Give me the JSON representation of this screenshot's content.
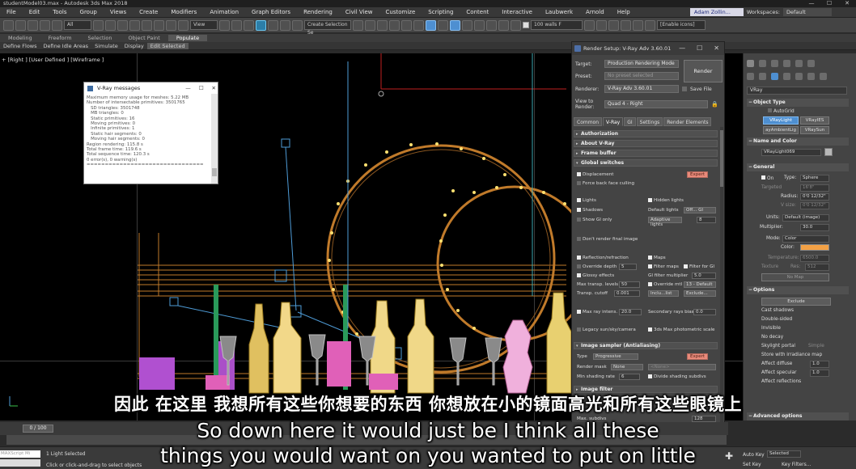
{
  "window": {
    "title": "studentModel03.max - Autodesk 3ds Max 2018",
    "controls": [
      "—",
      "☐",
      "✕"
    ]
  },
  "menubar": {
    "items": [
      "File",
      "Edit",
      "Tools",
      "Group",
      "Views",
      "Create",
      "Modifiers",
      "Animation",
      "Graph Editors",
      "Rendering",
      "Civil View",
      "Customize",
      "Scripting",
      "Content",
      "Interactive",
      "Laubwerk",
      "Arnold",
      "Help"
    ],
    "user": "Adam Zollin...",
    "workspaces_label": "Workspaces:",
    "workspace_value": "Default"
  },
  "toolbar": {
    "selection_filter": "All",
    "view_label": "View",
    "selection_set": "Create Selection Se",
    "layer_value": "100",
    "layer_name": "walls F",
    "enable_icons": "[Enable icons]"
  },
  "ribbon": {
    "tabs": [
      "Modeling",
      "Freeform",
      "Selection",
      "Object Paint",
      "Populate"
    ],
    "active_tab": "Populate",
    "sub_items": [
      "Define Flows",
      "Define Idle Areas",
      "Simulate",
      "Display",
      "Edit Selected"
    ],
    "active_sub": "Edit Selected"
  },
  "viewport": {
    "label": "+ [Right ] [User Defined ] [Wireframe ]"
  },
  "vray_messages": {
    "title": "V-Ray messages",
    "lines": [
      "Maximum memory usage for meshes: 5.22 MB",
      "Number of intersectable primitives: 3501765",
      "   SD triangles: 3501748",
      "   MB triangles: 0",
      "   Static primitives: 16",
      "   Moving primitives: 0",
      "   Infinite primitives: 1",
      "   Static hair segments: 0",
      "   Moving hair segments: 0",
      "Region rendering: 115.8 s",
      "Total frame time: 119.6 s",
      "Total sequence time: 120.3 s",
      "0 error(s), 0 warning(s)",
      "================================"
    ]
  },
  "render_setup": {
    "title": "Render Setup: V-Ray Adv 3.60.01",
    "target_label": "Target:",
    "target_value": "Production Rendering Mode",
    "preset_label": "Preset:",
    "preset_value": "No preset selected",
    "renderer_label": "Renderer:",
    "renderer_value": "V-Ray Adv 3.60.01",
    "save_file": "Save File",
    "view_label": "View to Render:",
    "view_value": "Quad 4 - Right",
    "render_button": "Render",
    "tabs": [
      "Common",
      "V-Ray",
      "GI",
      "Settings",
      "Render Elements"
    ],
    "active_tab": "V-Ray",
    "rollouts": {
      "authorization": "Authorization",
      "about": "About V-Ray",
      "frame_buffer": "Frame buffer",
      "global_switches": "Global switches",
      "image_sampler": "Image sampler (Antialiasing)",
      "image_filter": "Image filter"
    },
    "global": {
      "displacement": "Displacement",
      "expert": "Expert",
      "force_back": "Force back face culling",
      "lights": "Lights",
      "hidden_lights": "Hidden lights",
      "shadows": "Shadows",
      "default_lights": "Default lights",
      "default_lights_value": "Off... GI",
      "show_gi_only": "Show GI only",
      "adaptive_lights": "Adaptive lights",
      "adaptive_value": "8",
      "dont_render": "Don't render final image",
      "reflection_refraction": "Reflection/refraction",
      "maps": "Maps",
      "override_depth": "Override depth",
      "override_depth_value": "5",
      "filter_maps": "Filter maps",
      "filter_for_gi": "Filter for GI",
      "glossy_effects": "Glossy effects",
      "gi_filter_multiplier": "GI filter multiplier",
      "gi_filter_value": "5.0",
      "max_transp_levels": "Max transp. levels",
      "max_transp_value": "50",
      "override_mtl": "Override mtl",
      "override_mtl_value": "13 - Default",
      "transp_cutoff": "Transp. cutoff",
      "transp_cutoff_value": "0.001",
      "include_value": "Inclu...list",
      "exclude": "Exclude...",
      "max_ray_intens": "Max ray intens.",
      "max_ray_value": "20.0",
      "secondary_rays_bias": "Secondary rays bias",
      "secondary_value": "0.0",
      "legacy_sun": "Legacy sun/sky/camera",
      "photometric": "3ds Max photometric scale"
    },
    "sampler": {
      "type_label": "Type",
      "type_value": "Progressive",
      "expert": "Expert",
      "render_mask_label": "Render mask",
      "render_mask_value": "None",
      "none_value": "<None>",
      "min_shading_label": "Min shading rate",
      "min_shading_value": "6",
      "divide_shading": "Divide shading subdivs",
      "max_subdivs_label": "Max. subdivs",
      "bundle_value": "128"
    }
  },
  "command_panel": {
    "dropdown": "VRay",
    "object_type": "Object Type",
    "autogrid": "AutoGrid",
    "buttons": [
      "VRayLight",
      "VRayIES",
      "ayAmbientLig",
      "VRaySun"
    ],
    "active_button": "VRayLight",
    "name_and_color": "Name and Color",
    "name_value": "VRayLight069",
    "general": "General",
    "on_label": "On",
    "type_label": "Type:",
    "type_value": "Sphere",
    "targeted": "Targeted",
    "targeted_value": "16'8\"",
    "radius_label": "Radius:",
    "radius_value": "0'0 12/32\"",
    "vsize_label": "V size:",
    "vsize_value": "0'0 12/32\"",
    "units_label": "Units:",
    "units_value": "Default (image)",
    "multiplier_label": "Multiplier:",
    "multiplier_value": "30.0",
    "mode_label": "Mode:",
    "mode_value": "Color",
    "color_label": "Color:",
    "color_hex": "#f3a145",
    "temperature_label": "Temperature:",
    "temperature_value": "6500.0",
    "texture_label": "Texture",
    "res_label": "Res:",
    "res_value": "512",
    "no_map": "No Map",
    "options": "Options",
    "exclude": "Exclude",
    "option_items": [
      "Cast shadows",
      "Double-sided",
      "Invisible",
      "No decay",
      "Skylight portal",
      "Simple",
      "Store with irradiance map",
      "Affect diffuse",
      "Affect specular",
      "Affect reflections"
    ],
    "affect_diffuse_value": "1.0",
    "affect_specular_value": "1.0",
    "advanced_options": "Advanced options"
  },
  "timeline": {
    "frame": "0 / 100"
  },
  "status": {
    "maxscript": "MAXScript Mi",
    "selection": "1 Light Selected",
    "prompt": "Click or click-and-drag to select objects",
    "auto_key": "Auto Key",
    "selected": "Selected",
    "set_key": "Set Key",
    "key_filters": "Key Filters..."
  },
  "subtitles": {
    "chinese": "因此 在这里 我想所有这些你想要的东西 你想放在小的镜面高光和所有这些眼镜上",
    "english_line1": "So down here it would just be I think all these",
    "english_line2": "things you would want on you wanted to put on little"
  }
}
